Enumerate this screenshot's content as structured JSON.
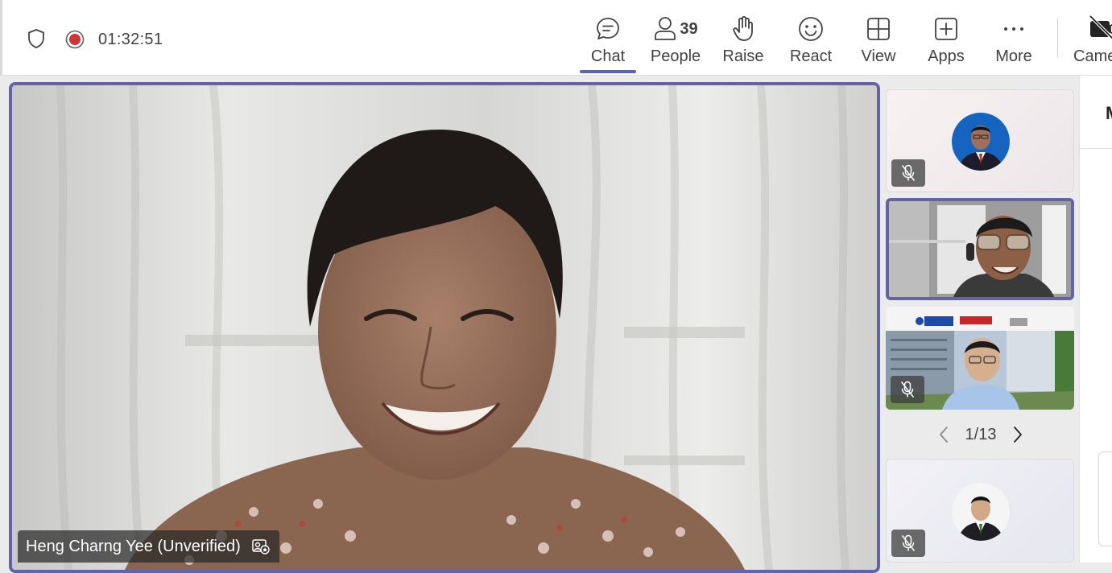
{
  "meeting": {
    "timer": "01:32:51",
    "recording": true
  },
  "toolbar": {
    "chat_label": "Chat",
    "people_label": "People",
    "people_count": "39",
    "raise_label": "Raise",
    "react_label": "React",
    "view_label": "View",
    "apps_label": "Apps",
    "more_label": "More",
    "camera_label": "Camera"
  },
  "stage": {
    "speaker_name": "Heng Charng Yee (Unverified)"
  },
  "rail": {
    "page_indicator": "1/13"
  },
  "side_panel": {
    "header_initial": "M"
  },
  "colors": {
    "accent": "#5b5fc7",
    "active_border": "#6264a7",
    "record_red": "#d13438"
  },
  "icons": [
    "shield-icon",
    "record-icon",
    "chat-icon",
    "people-icon",
    "raise-hand-icon",
    "react-icon",
    "view-icon",
    "apps-icon",
    "more-icon",
    "camera-off-icon",
    "mic-off-icon",
    "chevron-left-icon",
    "chevron-right-icon"
  ]
}
